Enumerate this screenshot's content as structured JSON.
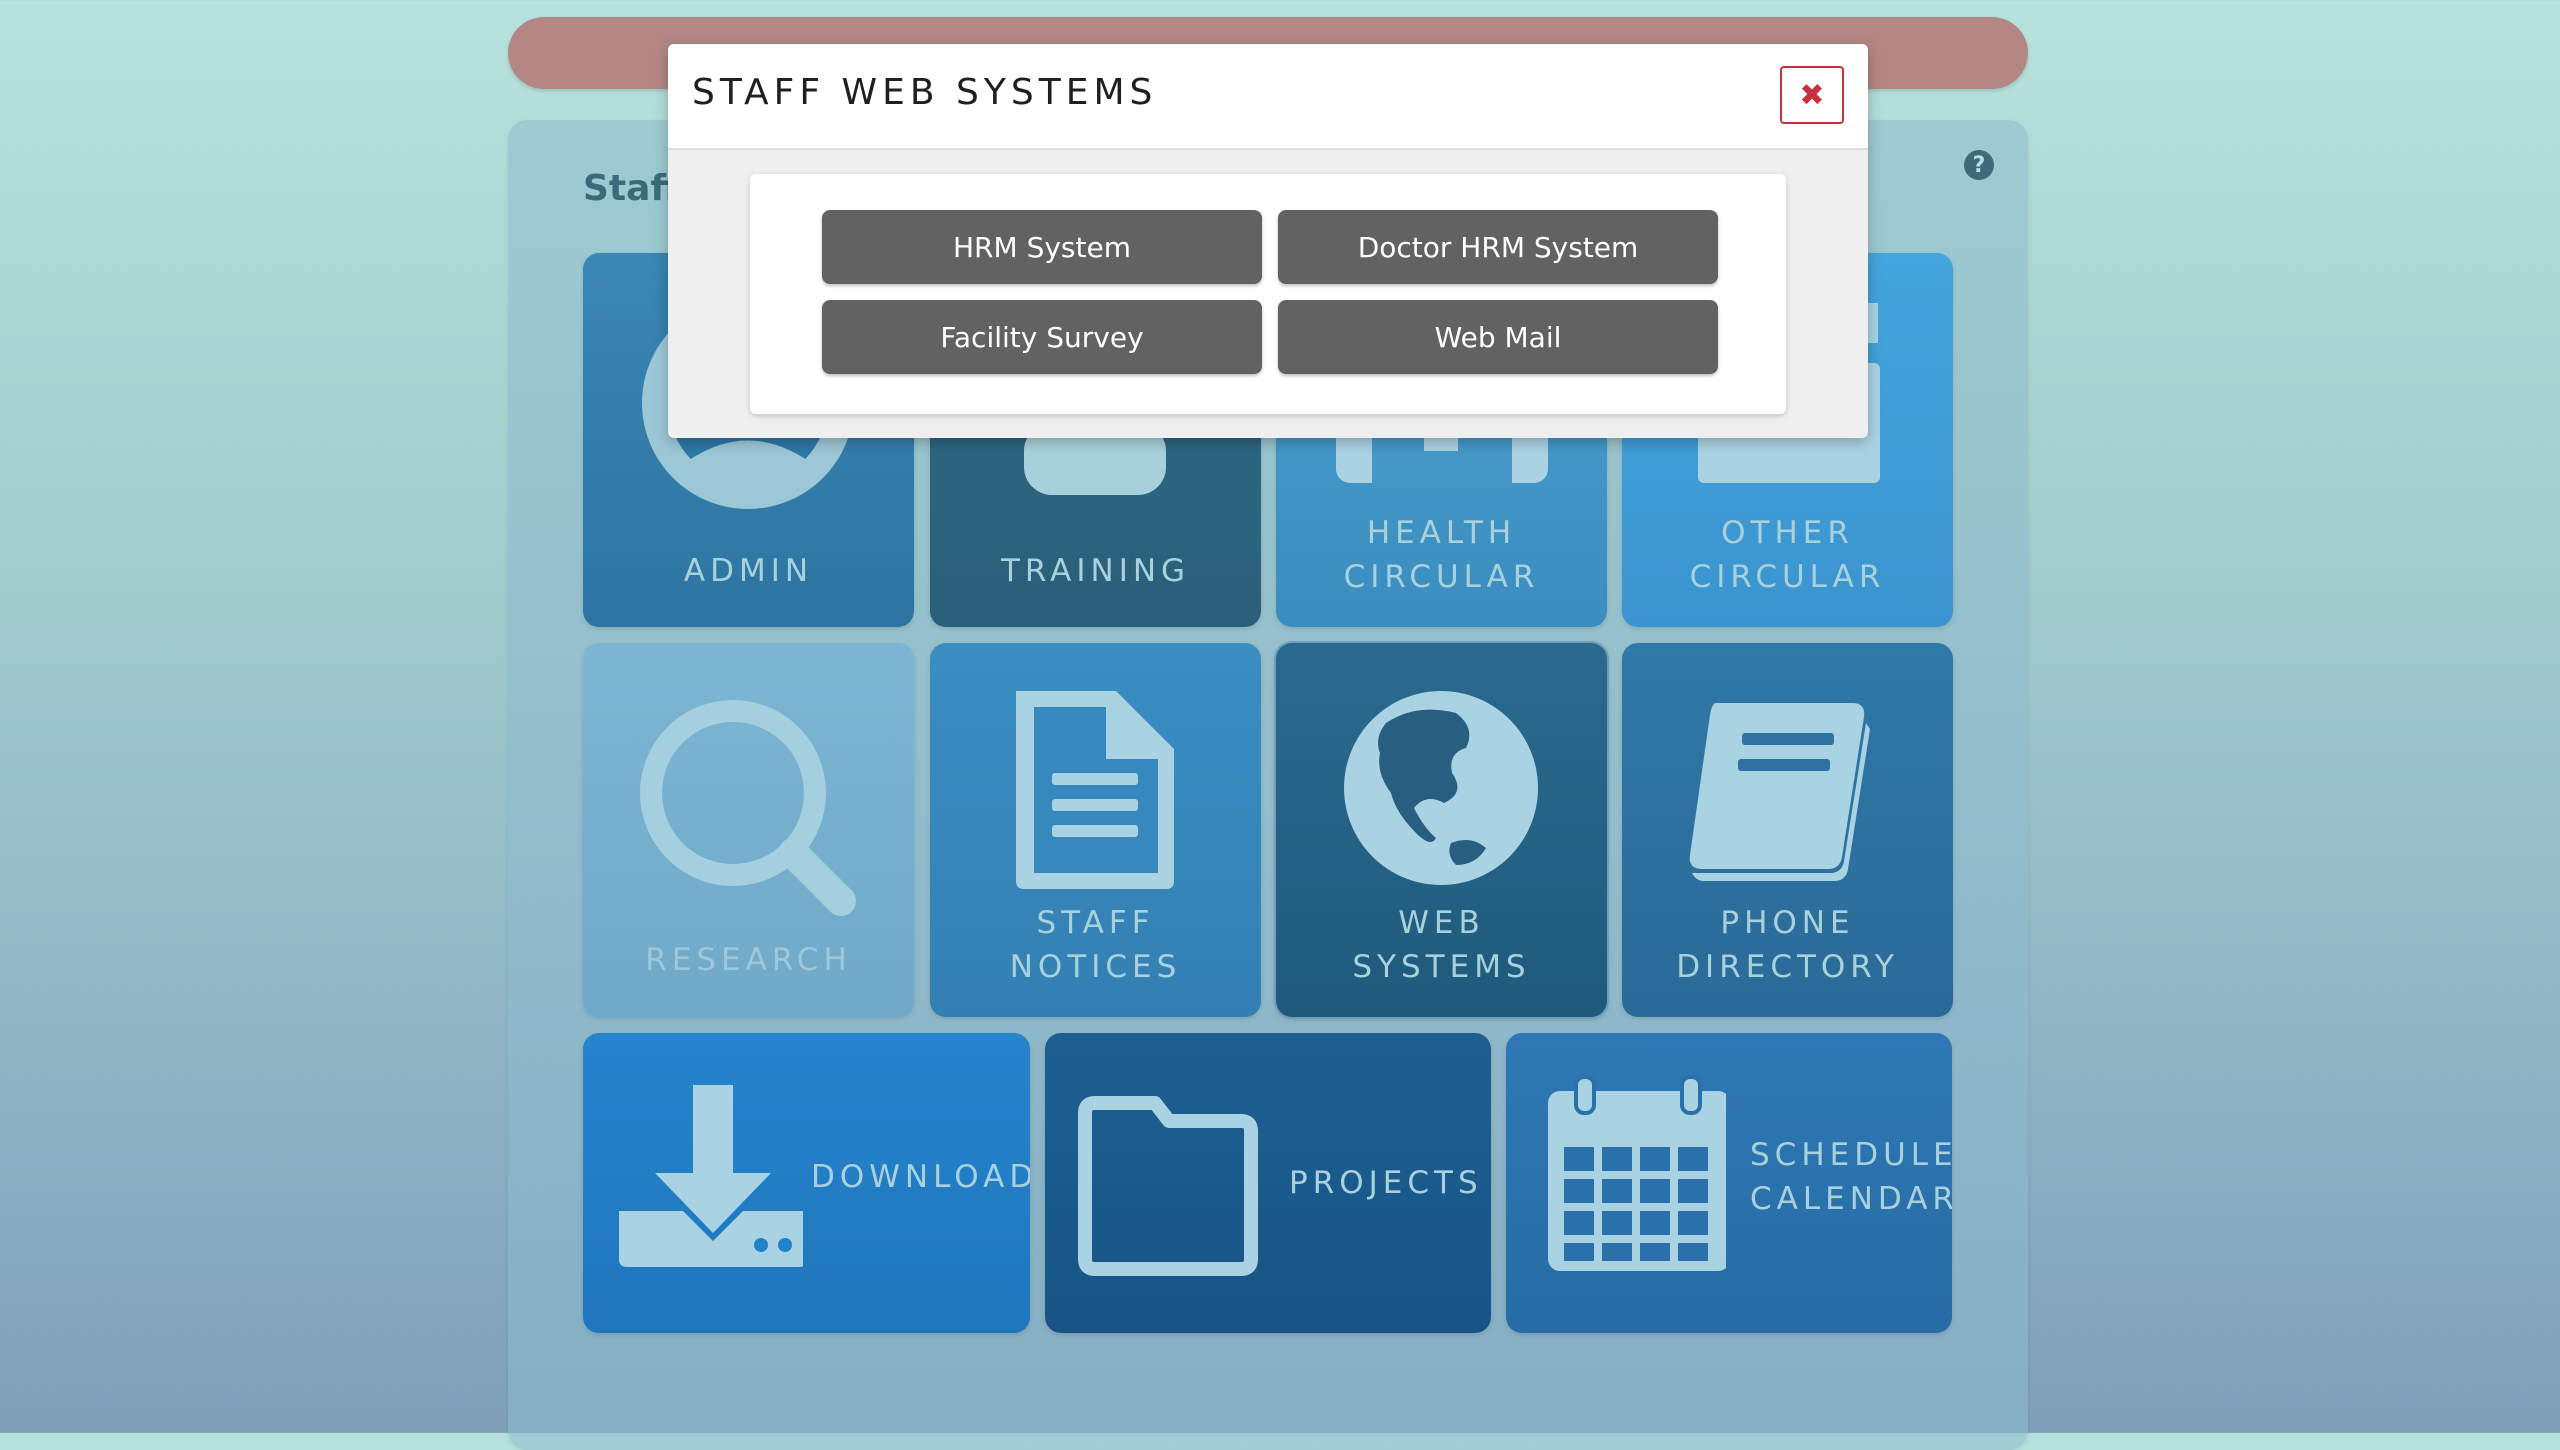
{
  "panel": {
    "title": "Staff"
  },
  "help": {
    "glyph": "?"
  },
  "tiles": {
    "admin": {
      "label": "ADMIN"
    },
    "training": {
      "label": "TRAINING"
    },
    "health": {
      "line1": "HEALTH",
      "line2": "CIRCULAR"
    },
    "other": {
      "line1": "OTHER",
      "line2": "CIRCULAR"
    },
    "research": {
      "label": "RESEARCH"
    },
    "notices": {
      "line1": "STAFF",
      "line2": "NOTICES"
    },
    "web": {
      "line1": "WEB",
      "line2": "SYSTEMS"
    },
    "phone": {
      "line1": "PHONE",
      "line2": "DIRECTORY"
    },
    "download": {
      "label": "DOWNLOAD"
    },
    "projects": {
      "label": "PROJECTS"
    },
    "schedule": {
      "line1": "SCHEDULE",
      "line2": "CALENDAR"
    }
  },
  "modal": {
    "title": "STAFF WEB SYSTEMS",
    "close_glyph": "✖",
    "buttons": {
      "hrm": "HRM System",
      "doctor_hrm": "Doctor HRM System",
      "facility": "Facility Survey",
      "webmail": "Web Mail"
    }
  },
  "colors": {
    "close": "#c9303e",
    "button": "#626262",
    "topbar": "#b48785"
  }
}
